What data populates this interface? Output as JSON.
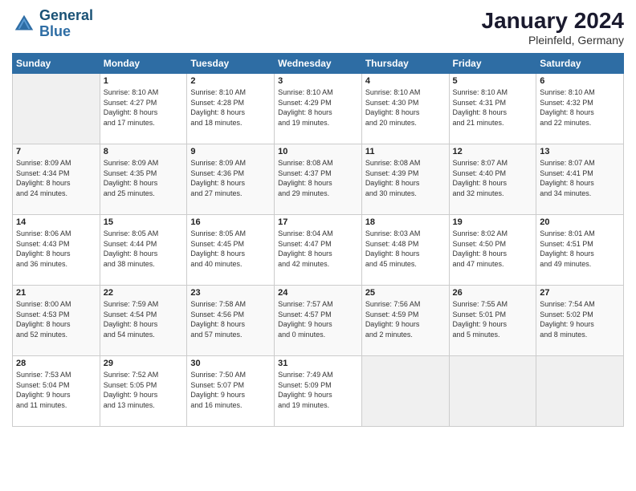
{
  "logo": {
    "line1": "General",
    "line2": "Blue"
  },
  "title": "January 2024",
  "location": "Pleinfeld, Germany",
  "days_of_week": [
    "Sunday",
    "Monday",
    "Tuesday",
    "Wednesday",
    "Thursday",
    "Friday",
    "Saturday"
  ],
  "weeks": [
    [
      {
        "day": "",
        "info": ""
      },
      {
        "day": "1",
        "info": "Sunrise: 8:10 AM\nSunset: 4:27 PM\nDaylight: 8 hours\nand 17 minutes."
      },
      {
        "day": "2",
        "info": "Sunrise: 8:10 AM\nSunset: 4:28 PM\nDaylight: 8 hours\nand 18 minutes."
      },
      {
        "day": "3",
        "info": "Sunrise: 8:10 AM\nSunset: 4:29 PM\nDaylight: 8 hours\nand 19 minutes."
      },
      {
        "day": "4",
        "info": "Sunrise: 8:10 AM\nSunset: 4:30 PM\nDaylight: 8 hours\nand 20 minutes."
      },
      {
        "day": "5",
        "info": "Sunrise: 8:10 AM\nSunset: 4:31 PM\nDaylight: 8 hours\nand 21 minutes."
      },
      {
        "day": "6",
        "info": "Sunrise: 8:10 AM\nSunset: 4:32 PM\nDaylight: 8 hours\nand 22 minutes."
      }
    ],
    [
      {
        "day": "7",
        "info": "Sunrise: 8:09 AM\nSunset: 4:34 PM\nDaylight: 8 hours\nand 24 minutes."
      },
      {
        "day": "8",
        "info": "Sunrise: 8:09 AM\nSunset: 4:35 PM\nDaylight: 8 hours\nand 25 minutes."
      },
      {
        "day": "9",
        "info": "Sunrise: 8:09 AM\nSunset: 4:36 PM\nDaylight: 8 hours\nand 27 minutes."
      },
      {
        "day": "10",
        "info": "Sunrise: 8:08 AM\nSunset: 4:37 PM\nDaylight: 8 hours\nand 29 minutes."
      },
      {
        "day": "11",
        "info": "Sunrise: 8:08 AM\nSunset: 4:39 PM\nDaylight: 8 hours\nand 30 minutes."
      },
      {
        "day": "12",
        "info": "Sunrise: 8:07 AM\nSunset: 4:40 PM\nDaylight: 8 hours\nand 32 minutes."
      },
      {
        "day": "13",
        "info": "Sunrise: 8:07 AM\nSunset: 4:41 PM\nDaylight: 8 hours\nand 34 minutes."
      }
    ],
    [
      {
        "day": "14",
        "info": "Sunrise: 8:06 AM\nSunset: 4:43 PM\nDaylight: 8 hours\nand 36 minutes."
      },
      {
        "day": "15",
        "info": "Sunrise: 8:05 AM\nSunset: 4:44 PM\nDaylight: 8 hours\nand 38 minutes."
      },
      {
        "day": "16",
        "info": "Sunrise: 8:05 AM\nSunset: 4:45 PM\nDaylight: 8 hours\nand 40 minutes."
      },
      {
        "day": "17",
        "info": "Sunrise: 8:04 AM\nSunset: 4:47 PM\nDaylight: 8 hours\nand 42 minutes."
      },
      {
        "day": "18",
        "info": "Sunrise: 8:03 AM\nSunset: 4:48 PM\nDaylight: 8 hours\nand 45 minutes."
      },
      {
        "day": "19",
        "info": "Sunrise: 8:02 AM\nSunset: 4:50 PM\nDaylight: 8 hours\nand 47 minutes."
      },
      {
        "day": "20",
        "info": "Sunrise: 8:01 AM\nSunset: 4:51 PM\nDaylight: 8 hours\nand 49 minutes."
      }
    ],
    [
      {
        "day": "21",
        "info": "Sunrise: 8:00 AM\nSunset: 4:53 PM\nDaylight: 8 hours\nand 52 minutes."
      },
      {
        "day": "22",
        "info": "Sunrise: 7:59 AM\nSunset: 4:54 PM\nDaylight: 8 hours\nand 54 minutes."
      },
      {
        "day": "23",
        "info": "Sunrise: 7:58 AM\nSunset: 4:56 PM\nDaylight: 8 hours\nand 57 minutes."
      },
      {
        "day": "24",
        "info": "Sunrise: 7:57 AM\nSunset: 4:57 PM\nDaylight: 9 hours\nand 0 minutes."
      },
      {
        "day": "25",
        "info": "Sunrise: 7:56 AM\nSunset: 4:59 PM\nDaylight: 9 hours\nand 2 minutes."
      },
      {
        "day": "26",
        "info": "Sunrise: 7:55 AM\nSunset: 5:01 PM\nDaylight: 9 hours\nand 5 minutes."
      },
      {
        "day": "27",
        "info": "Sunrise: 7:54 AM\nSunset: 5:02 PM\nDaylight: 9 hours\nand 8 minutes."
      }
    ],
    [
      {
        "day": "28",
        "info": "Sunrise: 7:53 AM\nSunset: 5:04 PM\nDaylight: 9 hours\nand 11 minutes."
      },
      {
        "day": "29",
        "info": "Sunrise: 7:52 AM\nSunset: 5:05 PM\nDaylight: 9 hours\nand 13 minutes."
      },
      {
        "day": "30",
        "info": "Sunrise: 7:50 AM\nSunset: 5:07 PM\nDaylight: 9 hours\nand 16 minutes."
      },
      {
        "day": "31",
        "info": "Sunrise: 7:49 AM\nSunset: 5:09 PM\nDaylight: 9 hours\nand 19 minutes."
      },
      {
        "day": "",
        "info": ""
      },
      {
        "day": "",
        "info": ""
      },
      {
        "day": "",
        "info": ""
      }
    ]
  ]
}
